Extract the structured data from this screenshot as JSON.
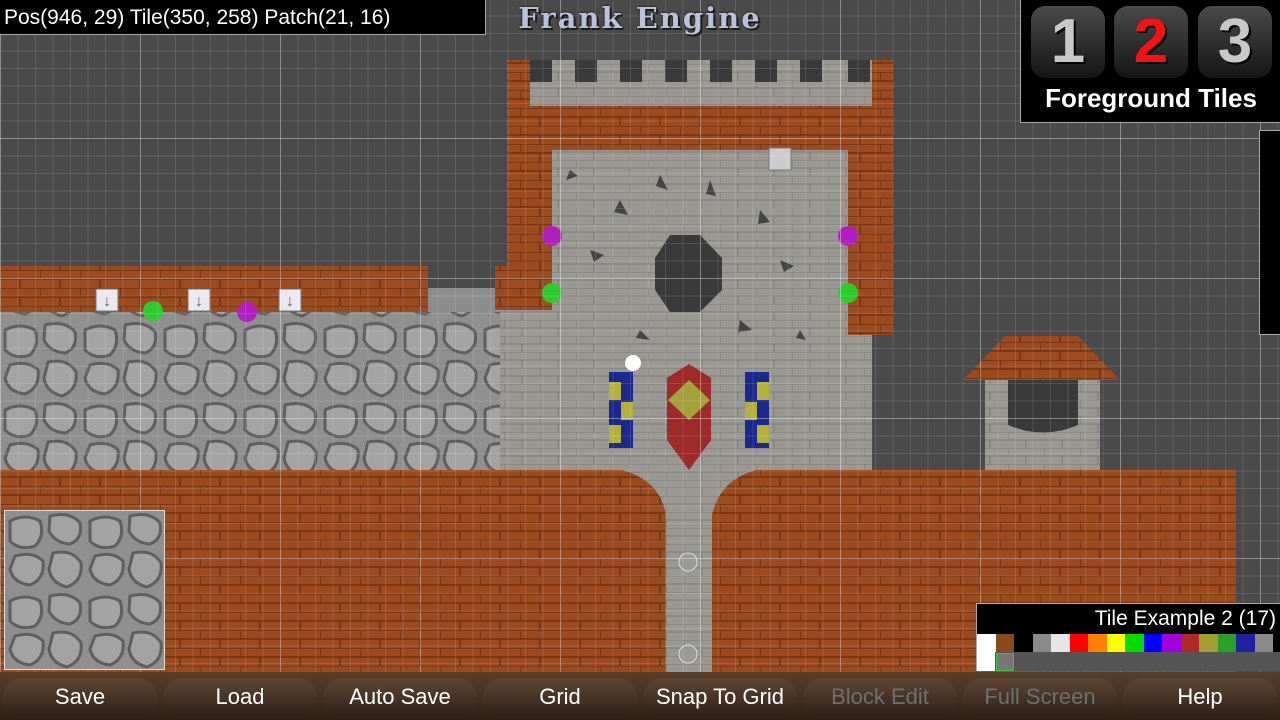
{
  "readout": {
    "text": "Pos(946, 29) Tile(350, 258) Patch(21, 16)"
  },
  "title": "Frank Engine",
  "layers": {
    "buttons": [
      {
        "label": "1"
      },
      {
        "label": "2"
      },
      {
        "label": "3"
      }
    ],
    "active_index": 1,
    "label": "Foreground Tiles",
    "active_color": "#ff1010",
    "inactive_color": "#c8c8c8"
  },
  "tile_panel": {
    "name": "Tile Example 2 (17)",
    "swatches": [
      "#ffffff",
      "#8b4a1c",
      "#000000",
      "#8a8a8a",
      "#e6e6e6",
      "#ff0000",
      "#ff7f00",
      "#ffff00",
      "#00dd00",
      "#0000ff",
      "#a000e0",
      "#b02828",
      "#a0a030",
      "#2aa02a",
      "#2020a0",
      "#8a8a8a"
    ]
  },
  "toolbar": {
    "buttons": [
      {
        "label": "Save",
        "enabled": true
      },
      {
        "label": "Load",
        "enabled": true
      },
      {
        "label": "Auto Save",
        "enabled": true
      },
      {
        "label": "Grid",
        "enabled": true
      },
      {
        "label": "Snap To Grid",
        "enabled": true
      },
      {
        "label": "Block Edit",
        "enabled": false
      },
      {
        "label": "Full Screen",
        "enabled": false
      },
      {
        "label": "Help",
        "enabled": true
      }
    ]
  },
  "colors": {
    "brick": "#9c4a1e",
    "stone": "#9a9893",
    "cobble": "#8c8c8c",
    "void": "#3a3a3a",
    "background": "#505050"
  }
}
